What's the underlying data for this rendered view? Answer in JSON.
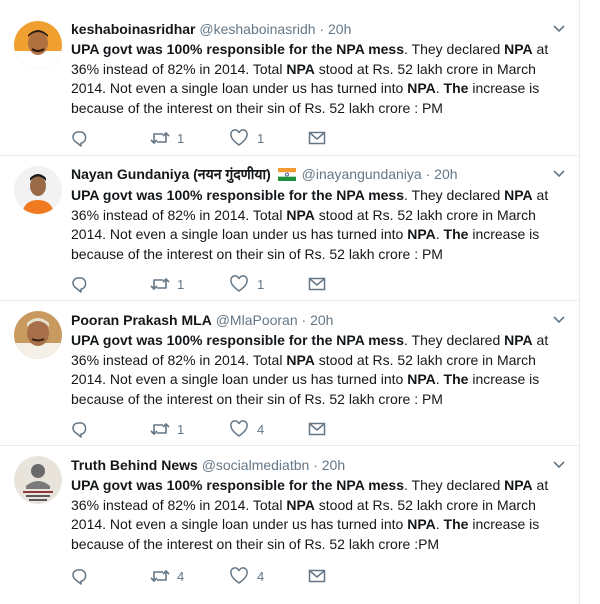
{
  "tweets": [
    {
      "name": "keshaboinasridhar",
      "handle": "@keshaboinasridh",
      "sep": "·",
      "time": "20h",
      "flag": false,
      "body_end": ": PM",
      "retweets": "1",
      "likes": "1",
      "avatar_bg": "#f0a030"
    },
    {
      "name": "Nayan Gundaniya (नयन गुंदणीया)",
      "handle": "@inayangundaniya",
      "sep": "·",
      "time": "20h",
      "flag": true,
      "body_end": ": PM",
      "retweets": "1",
      "likes": "1",
      "avatar_bg": "#f2f2f2"
    },
    {
      "name": "Pooran Prakash MLA",
      "handle": "@MlaPooran",
      "sep": "·",
      "time": "20h",
      "flag": false,
      "body_end": ": PM",
      "retweets": "1",
      "likes": "4",
      "avatar_bg": "#c89a60"
    },
    {
      "name": "Truth Behind News",
      "handle": "@socialmediatbn",
      "sep": "·",
      "time": "20h",
      "flag": false,
      "body_end": ":PM",
      "retweets": "4",
      "likes": "4",
      "avatar_bg": "#e8e4dc"
    }
  ],
  "body": {
    "p1": "UPA govt was 100%",
    "p2": " ",
    "p3": "responsible for the NPA mess",
    "p4": ". They declared ",
    "p5": "NPA",
    "p6": " at 36% instead of 82% in 2014. Total ",
    "p7": "NPA",
    "p8": " stood at Rs. 52 lakh crore in March 2014. Not even a single loan under us has turned into ",
    "p9": "NPA",
    "p10": ". ",
    "p11": "The",
    "p12": " increase is because of the interest on their sin of Rs. 52 lakh crore "
  },
  "icons": {
    "caret": "chevron-down-icon",
    "reply": "reply-icon",
    "retweet": "retweet-icon",
    "like": "heart-icon",
    "dm": "envelope-icon"
  },
  "colors": {
    "text": "#14171a",
    "muted": "#657786",
    "divider": "#e6ecf0"
  }
}
